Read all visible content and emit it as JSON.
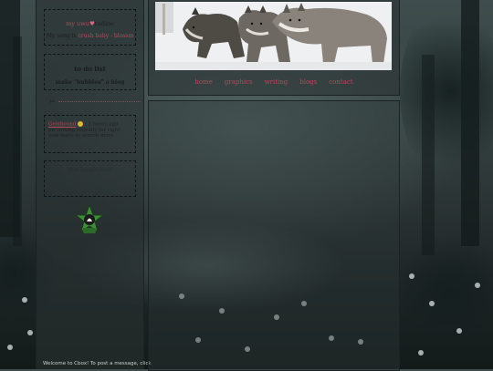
{
  "sidebar": {
    "now_playing": {
      "prefix": "my ",
      "heart_icon": "bow-heart-icon",
      "suffix": "radioo",
      "song_label": "My song is ",
      "song": "crush baby - blossm"
    },
    "todo": {
      "title": "to do list",
      "item": "make \"bubbles\" a blog"
    },
    "divider_icon": "ribbon-bow-icon",
    "chat": {
      "name": "Gemhound",
      "emoji": "smiley-icon",
      "time": " - 3 hours ago",
      "message": "im looking reeeally for right now more to scorch more"
    },
    "fortune": {
      "text": "live laugh love"
    },
    "badge_icon": "green-star-badge-icon",
    "footer_message": "Welcome to Cbox! To post a message, click"
  },
  "header": {
    "banner_alt": "three wolves",
    "nav": [
      "home",
      "graphics",
      "writing",
      "blogs",
      "contact"
    ]
  },
  "colors": {
    "accent": "#b8485c",
    "panel": "#2d3737"
  }
}
